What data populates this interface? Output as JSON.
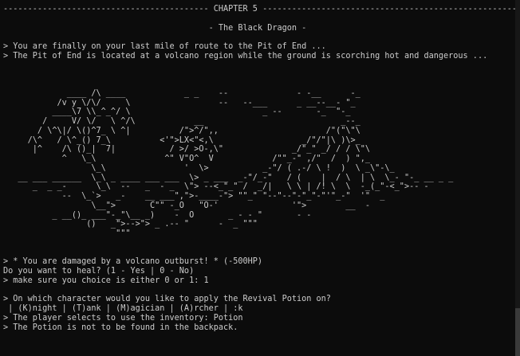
{
  "header": {
    "chapter_line": "------------------------------------------ CHAPTER 5 -------------------------------------------------------",
    "subtitle": "- The Black Dragon -"
  },
  "narration": [
    "> You are finally on your last mile of route to the Pit of End ...",
    "> The Pit of End is located at a volcano region while the ground is scorching hot and dangerous ..."
  ],
  "ascii_art": [
    "             ____ /\\ ____            _ _    --              - -__      -_",
    "           /v y \\/\\/     \\                  --   --___      _ __--__- \"_",
    "          ____\\7 \\\\_^_^/ \\                           _ --       -_  \"-_",
    "        /     V/ \\/   \\ ^/\\            __                            _--_",
    "       / \\^\\|/ \\()^7_ \\ ^|          /\">^/\",,                      /\"(\"\\\"\\",
    "     /\\^   / \\^_() 7_\\          <'\">LX<\"<,\\                  _/\"/\"|\\ )\\>_",
    "      |^    /\\ ()_|  7|           / >/ >O-,\\\"              _/\"_\" _/ / / \\\"\\",
    "            ^   \\_\\              ^\" V\"O^  V            /\"\"_-\" ,/\"  /  ) \",_",
    "                  \\_\\                '  \\>           _-\"/ ( .-/ \\ !  )  \\ _\\\"-\\_",
    "   __ ___ ______  \\_\\ _ ____ ___ ___  \\> _ ___  _-\"/_-\"   / (    |  / \\  | \\  \\_- \"-_ __ _ _",
    "      _  _ _-      \\_\\  --   _  - _  \\\"> --<_\"_\" /  _/|   \\ \\ | /! \\  \\  -_(_\"-<_\">-- -",
    "            --  \\_`>   _-    __ ___\",\">-____-\"> \"\"_\" \"--\"--\"-\"_\"-\"'\"_-\"  '\"  _",
    "                  \\__\">       C\"\" -_O   \"O-'               '\">        __  -",
    "          _ __()_ ___\"-_\"\\__ _)    -  O       _ - - \"       - -",
    "                 ()   _\">-->\"> _ .-- \"      -  _ \"\"\"",
    "                       \"\"\""
  ],
  "log": [
    "> * You are damaged by a volcano outburst! * (-500HP)",
    "Do you want to heal? (1 - Yes | 0 - No)",
    "> make sure you choice is either 0 or 1: 1",
    "",
    "> On which character would you like to apply the Revival Potion on?",
    " | (K)night | (T)ank | (M)agician | (A)rcher | :k",
    "> The player selects to use the inventory: Potion",
    "> The Potion is not to be found in the backpack."
  ]
}
